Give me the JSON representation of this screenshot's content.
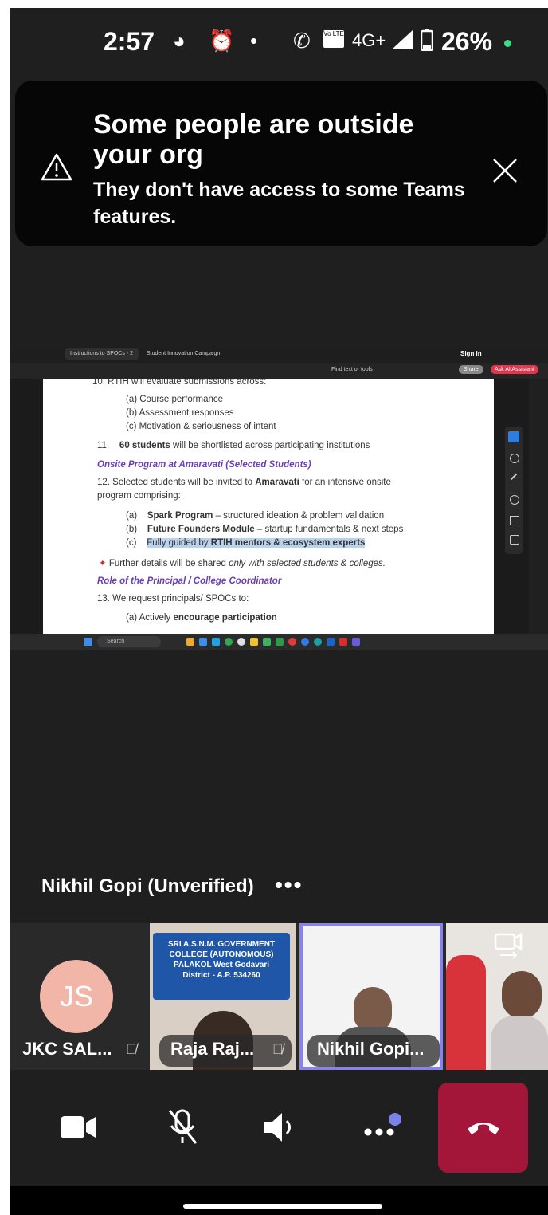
{
  "status_bar": {
    "time": "2:57",
    "network": "4G+",
    "battery": "26%",
    "volte": "Vo LTE"
  },
  "banner": {
    "title": "Some people are outside your org",
    "subtitle": "They don't have access to some Teams features."
  },
  "shared_screen": {
    "browser_tabs": [
      "Instructions to SPOCs - 2",
      "Student Innovation Campaign"
    ],
    "sign_in": "Sign in",
    "toolbar_right": [
      "Find text or tools",
      "Share",
      "Ask AI Assistant"
    ],
    "document_lines": [
      "10.    RTIH will evaluate submissions across:",
      "(a)    Course performance",
      "(b)    Assessment responses",
      "(c)    Motivation & seriousness of intent",
      "11.",
      "60 students",
      "will be shortlisted across participating institutions",
      "Onsite Program at Amaravati (Selected Students)",
      "12.    Selected students will be invited to",
      "Amaravati",
      "for an intensive onsite",
      "program comprising:",
      "(a)",
      "Spark Program",
      "– structured ideation & problem validation",
      "(b)",
      "Future Founders Module",
      "– startup fundamentals & next steps",
      "(c)",
      "Fully guided by",
      "RTIH mentors & ecosystem experts",
      "Further details will be shared",
      "only",
      "with selected students & colleges.",
      "Role of the Principal / College Coordinator",
      "13.    We request principals/ SPOCs to:",
      "(a)    Actively",
      "encourage participation"
    ],
    "taskbar_search": "Search"
  },
  "presenter": {
    "name": "Nikhil Gopi (Unverified)",
    "more": "•••"
  },
  "participants": [
    {
      "initials": "JS",
      "label": "JKC SAL...",
      "muted": true
    },
    {
      "label": "Raja Raj...",
      "muted": true,
      "banner_text": "SRI A.S.N.M. GOVERNMENT COLLEGE (AUTONOMOUS) PALAKOL West Godavari District - A.P. 534260"
    },
    {
      "label": "Nikhil Gopi...",
      "active": true
    },
    {
      "label": ""
    }
  ],
  "controls": [
    "camera-button",
    "mute-button",
    "speaker-button",
    "more-button",
    "hangup-button"
  ],
  "colors": {
    "background": "#1f1f1f",
    "banner": "#060606",
    "hangup": "#a4153a",
    "avatar": "#f1b6a8",
    "active_border": "#8a83e6",
    "notification_dot": "#7b83eb"
  }
}
